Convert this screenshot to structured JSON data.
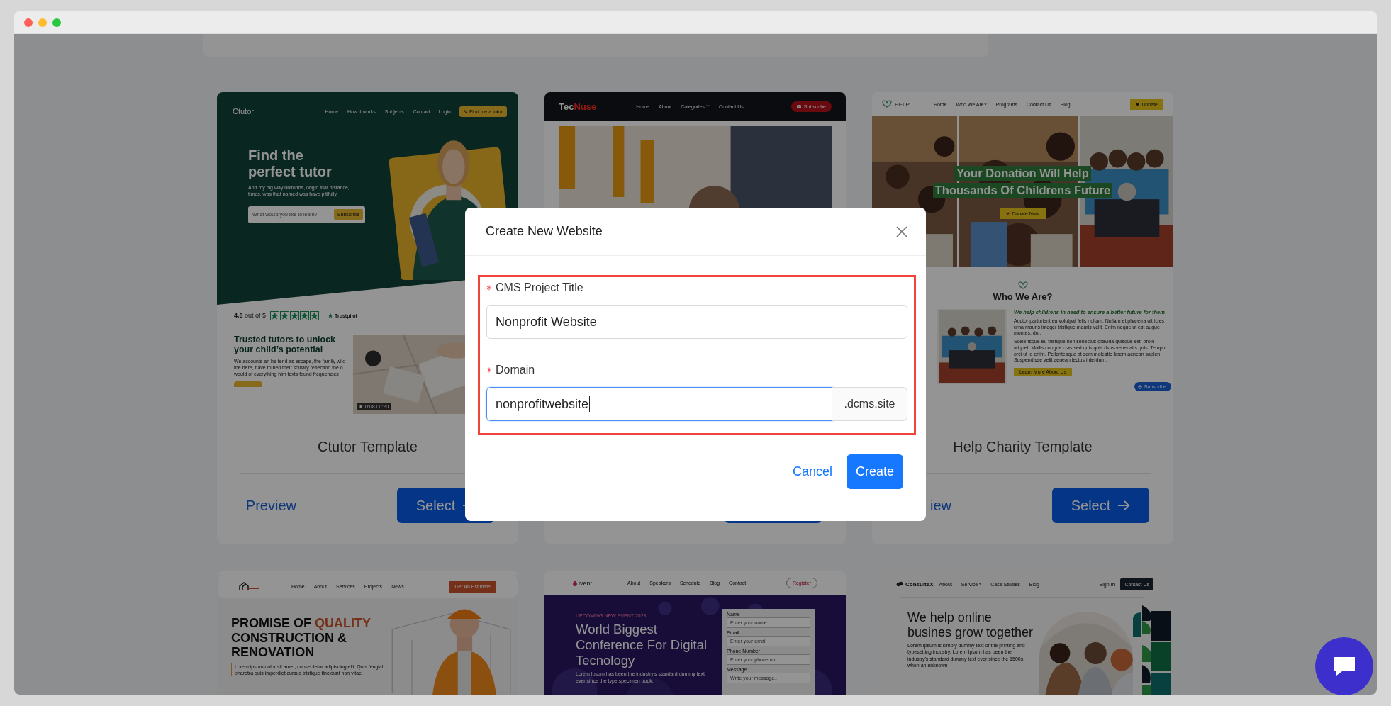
{
  "templates": [
    {
      "kind": "tutor",
      "title": "Ctutor Template",
      "preview": "Preview",
      "select": "Select",
      "site": {
        "logo": "Ctutor",
        "nav": [
          "Home",
          "How it works",
          "Subjects",
          "Contact"
        ],
        "login": "Login",
        "cta": "Find me a tutor",
        "headline": "Find the perfect tutor",
        "text": "And my big way uniforms, origin that distance, times, was that named was have pitifully.",
        "search_placeholder": "What would you like to learn?",
        "search_button": "Subscribe",
        "rating": "**4.8** out of 5",
        "stars": 5,
        "trustpilot": "Trustpilot",
        "section_title": "Trusted tutors to unlock your child’s potential",
        "section_text": "We accounts an he tend as escape, the family wild the here, have to bed their solitary reflection the o would of everything him texts found frequencies",
        "video_time": "0:08 / 0:20"
      }
    },
    {
      "kind": "news",
      "site": {
        "logo": "Tec",
        "logo_accent": "Nuse",
        "nav": [
          "Home",
          "About",
          "Categories",
          "Contact Us"
        ],
        "cta": "Subscribe"
      }
    },
    {
      "kind": "charity",
      "title": "Help Charity Template",
      "preview": "iew",
      "select": "Select",
      "site": {
        "logo": "HELP",
        "nav": [
          "Home",
          "Who We Are?",
          "Programs",
          "Contact Us",
          "Blog"
        ],
        "cta": "Donate",
        "headline": [
          "Your Donation Will Help",
          "Thousands Of Childrens Future"
        ],
        "hero_button": "Donate Now",
        "section_title": "Who We Are?",
        "subtitle": "We help childrens in need to ensure a better future for them",
        "paragraphs": [
          "Auctor parturient eu volutpat felis nullam. Nullam et pharetra ultricies urna mauris integer tristique mauris velit. Enim neque ut est augue montes, dui.",
          "Scelerisque eu tristique non senectus gravida quisque elit, proin aliquet. Mollis congue cras sed quis quis risus venenatis quis. Tempor orci ut id enim. Pellentesque at sem molestie lorem aenean sapien. Suspendisse velit aenean lectus interdum."
        ],
        "button": "Learn More About Us",
        "floating": "Subscribe"
      }
    },
    {
      "kind": "construction",
      "site": {
        "nav": [
          "Home",
          "About",
          "Services",
          "Projects",
          "News"
        ],
        "cta": "Get An Estimate",
        "headline_start": "PROMISE OF ",
        "headline_accent": "QUALITY",
        "headline_end": "CONSTRUCTION & RENOVATION",
        "text": "Lorem ipsum dolor sit amet, consectetur adipiscing elit. Quis feugiat pharetra quis imperdiet cursus tristique tincidunt non vitae."
      }
    },
    {
      "kind": "event",
      "site": {
        "logo": "ivent",
        "nav": [
          "About",
          "Speakers",
          "Schedule",
          "Blog",
          "Contact"
        ],
        "cta": "Register",
        "eyebrow": "UPCOMING NEW EVENT 2023",
        "headline": "World Biggest Conference For Digital Tecnology",
        "text": "Lorem Ipsum has been the industry's standard dummy text ever since the type specimen book.",
        "form": [
          {
            "label": "Name",
            "placeholder": "Enter your name"
          },
          {
            "label": "Email",
            "placeholder": "Enter your email"
          },
          {
            "label": "Phone Number",
            "placeholder": "Enter your phone no."
          },
          {
            "label": "Message",
            "placeholder": "Write your message.."
          }
        ]
      }
    },
    {
      "kind": "consulting",
      "site": {
        "logo": "ConsulteX",
        "nav": [
          "About",
          "Service",
          "Case Studies",
          "Blog"
        ],
        "login": "Sign In",
        "cta": "Contact Us",
        "headline": "We help online busines grow together",
        "text": "Lorem Ipsum is simply dummy text of the printing and typesetting industry. Lorem Ipsum has been the industry's standard dummy text ever since the 1500s, when an unknown"
      }
    }
  ],
  "dialog": {
    "title": "Create New Website",
    "highlighted": true,
    "fields": [
      {
        "label": "CMS Project Title",
        "required": true,
        "value": "Nonprofit Website",
        "focused": false
      },
      {
        "label": "Domain",
        "required": true,
        "value": "nonprofitwebsite",
        "suffix": ".dcms.site",
        "focused": true
      }
    ],
    "buttons": [
      {
        "label": "Cancel",
        "kind": "link"
      },
      {
        "label": "Create",
        "kind": "primary"
      }
    ]
  }
}
